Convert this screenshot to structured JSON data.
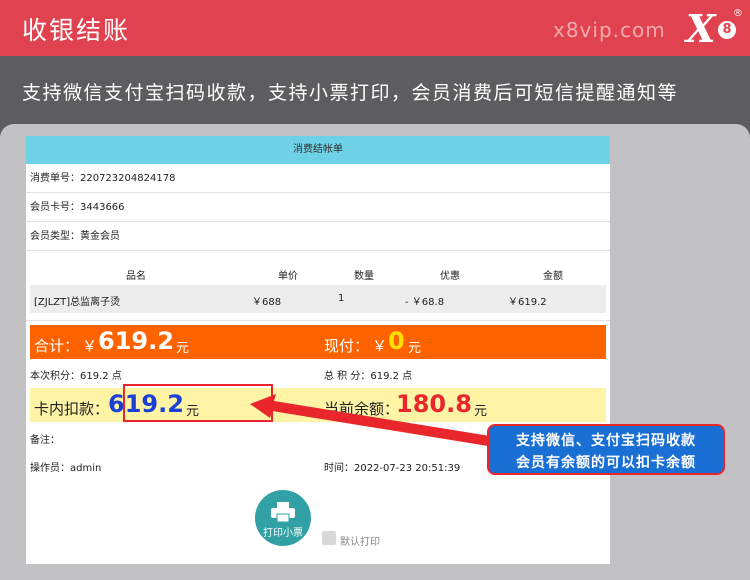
{
  "header": {
    "title": "收银结账",
    "site": "x8vip.com",
    "logo_letter": "X",
    "logo_number": "8",
    "logo_mark": "®"
  },
  "banner": {
    "text": "支持微信支付宝扫码收款，支持小票打印，会员消费后可短信提醒通知等"
  },
  "receipt": {
    "title": "消费结帐单",
    "order_no": "消费单号：220723204824178",
    "card_no": "会员卡号：3443666",
    "member_type": "会员类型：黄金会员",
    "columns": [
      "品名",
      "单价",
      "数量",
      "优惠",
      "金额"
    ],
    "item": {
      "name": "[ZJLZT]总监离子烫",
      "price": "￥688",
      "qty": "1",
      "discount": "- ￥68.8",
      "amount": "￥619.2"
    },
    "total_label": "合计：",
    "total_currency": "￥",
    "total_value": "619.2",
    "total_unit": "元",
    "cash_label": "现付：",
    "cash_currency": "￥",
    "cash_value": "0",
    "cash_unit": "元",
    "points_this": "本次积分：619.2 点",
    "points_total": "总 积 分：619.2 点",
    "card_deduct_label": "卡内扣款：",
    "card_deduct_value": "619.2",
    "card_deduct_unit": "元",
    "balance_label": "当前余额：",
    "balance_value": "180.8",
    "balance_unit": "元",
    "note_label": "备注：",
    "operator": "操作员：admin",
    "time": "时间：2022-07-23 20:51:39",
    "print_button": "打印小票",
    "default_print": "默认打印"
  },
  "callout": {
    "line1": "支持微信、支付宝扫码收款",
    "line2": "会员有余额的可以扣卡余额"
  },
  "colors": {
    "header_red": "#e0424f",
    "title_cyan": "#6fd1e6",
    "sum_orange": "#ff6300",
    "card_yellow": "#fff3a6",
    "balance_red": "#e8262c",
    "deduct_blue": "#1a3fd4",
    "print_teal": "#32a1a6",
    "callout_blue": "#1a6fd4"
  }
}
